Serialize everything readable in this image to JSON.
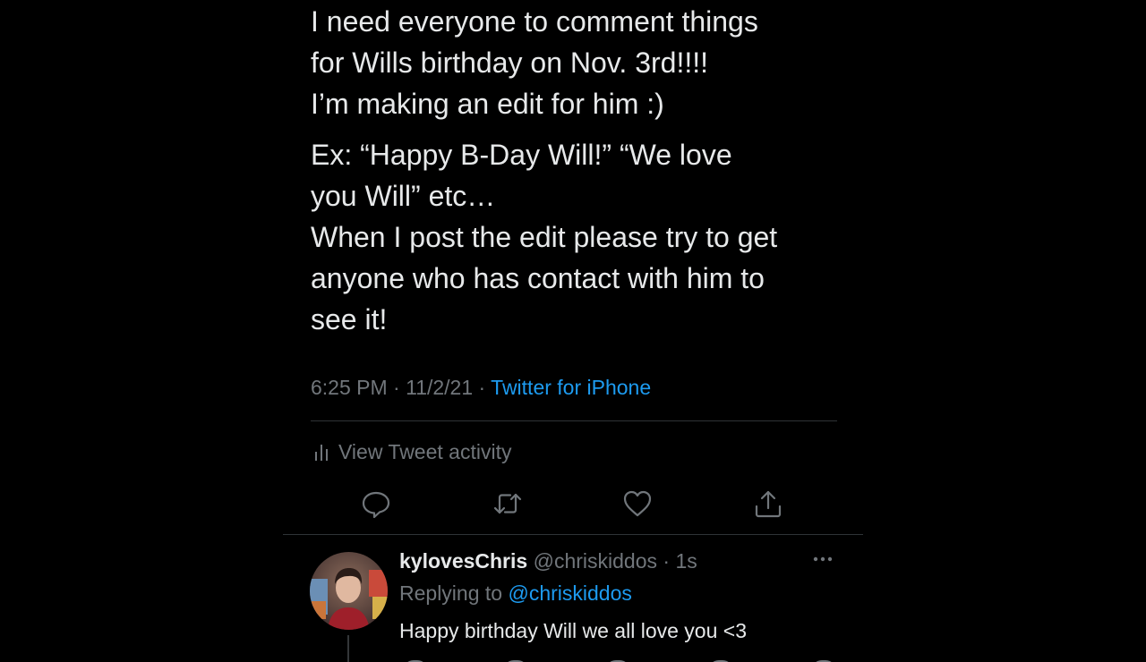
{
  "tweet": {
    "paragraph1": "I need everyone to comment things\nfor Wills birthday on Nov. 3rd!!!!\nI’m making an edit for him :)",
    "paragraph2": "Ex: “Happy B-Day Will!”  “We love\nyou Will” etc…\nWhen I post the edit please try to get\nanyone who has contact with him to\nsee it!",
    "time": "6:25 PM",
    "separator1": " · ",
    "date": "11/2/21",
    "separator2": " · ",
    "source": "Twitter for iPhone",
    "activity_label": "View Tweet activity"
  },
  "actions": {
    "icons": [
      "reply-icon",
      "retweet-icon",
      "like-icon",
      "share-icon"
    ]
  },
  "reply": {
    "display_name": "kylovesChris",
    "handle": "@chriskiddos",
    "separator": " · ",
    "time_ago": "1s",
    "replying_to_label": "Replying to ",
    "replying_to_handle": "@chriskiddos",
    "text": "Happy birthday Will we all love you <3"
  },
  "colors": {
    "background": "#000000",
    "text": "#e7e9ea",
    "secondary": "#71767b",
    "accent": "#1d9bf0",
    "divider": "#2f3336"
  }
}
